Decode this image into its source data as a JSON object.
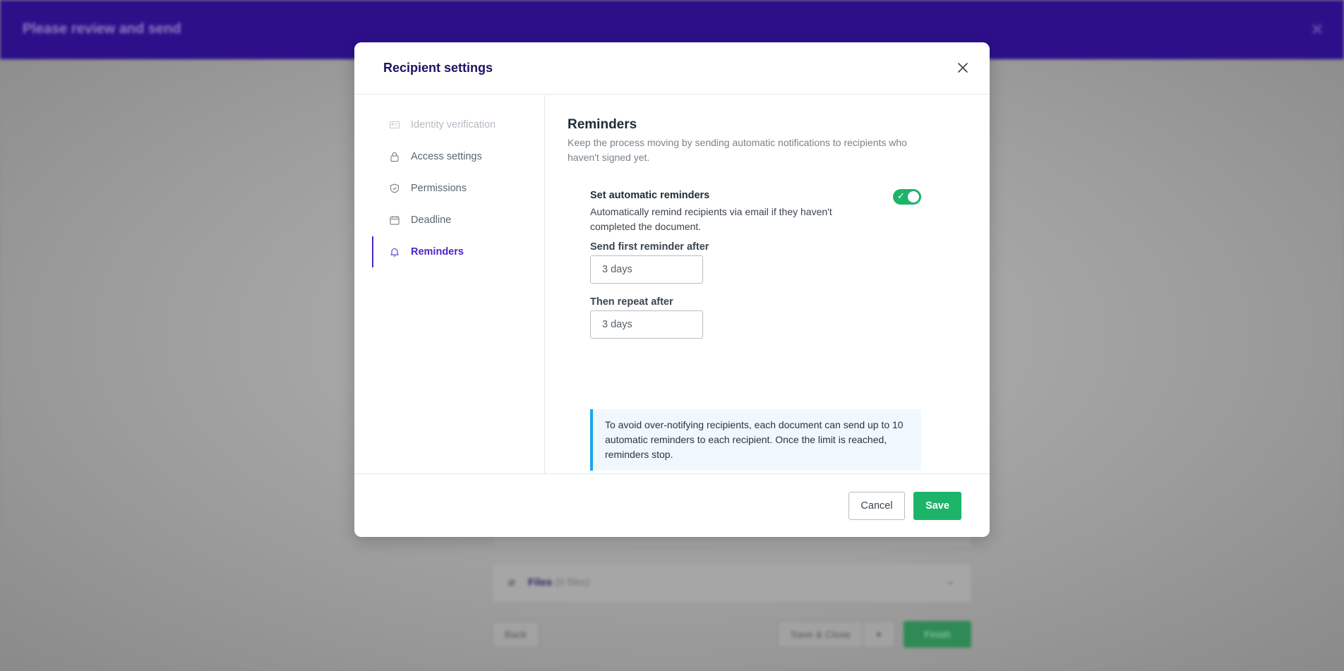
{
  "background": {
    "header_title": "Please review and send",
    "files_label": "Files",
    "files_count": "(0 files)",
    "back_label": "Back",
    "save_close_label": "Save & Close",
    "finish_label": "Finish"
  },
  "modal": {
    "title": "Recipient settings",
    "nav": [
      {
        "label": "Identity verification",
        "icon": "id-card-icon",
        "state": "disabled"
      },
      {
        "label": "Access settings",
        "icon": "lock-icon",
        "state": "normal"
      },
      {
        "label": "Permissions",
        "icon": "shield-icon",
        "state": "normal"
      },
      {
        "label": "Deadline",
        "icon": "calendar-icon",
        "state": "normal"
      },
      {
        "label": "Reminders",
        "icon": "bell-icon",
        "state": "active"
      }
    ],
    "reminders": {
      "title": "Reminders",
      "description": "Keep the process moving by sending automatic notifications to recipients who haven't signed yet.",
      "auto_label": "Set automatic reminders",
      "auto_description": "Automatically remind recipients via email if they haven't completed the document.",
      "auto_enabled": true,
      "first_label": "Send first reminder after",
      "first_value": "3 days",
      "repeat_label": "Then repeat after",
      "repeat_value": "3 days",
      "info": "To avoid over-notifying recipients, each document can send up to 10 automatic reminders to each recipient. Once the limit is reached, reminders stop."
    },
    "footer": {
      "cancel_label": "Cancel",
      "save_label": "Save"
    }
  },
  "colors": {
    "accent": "#4c24c9",
    "primary_green": "#1db46a",
    "header_bg": "#2d0f8a",
    "info_border": "#1aa7ec"
  }
}
